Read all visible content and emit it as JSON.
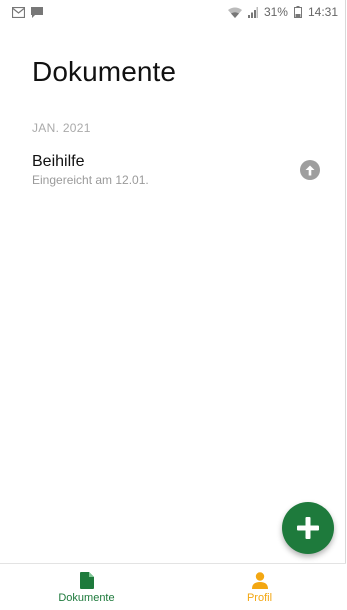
{
  "status_bar": {
    "battery_percent": "31%",
    "time": "14:31",
    "left_icons": [
      "mail-icon",
      "message-icon"
    ],
    "right_icons": [
      "wifi-icon",
      "signal-icon",
      "battery-icon"
    ]
  },
  "page": {
    "title": "Dokumente"
  },
  "sections": [
    {
      "header": "JAN. 2021",
      "items": [
        {
          "title": "Beihilfe",
          "subtitle": "Eingereicht am 12.01.",
          "status_icon": "arrow-up-icon"
        }
      ]
    }
  ],
  "fab": {
    "icon": "plus-icon",
    "color": "#1e7a3c"
  },
  "bottom_nav": {
    "items": [
      {
        "label": "Dokumente",
        "icon": "document-icon",
        "active": true,
        "color": "#1e7a3c"
      },
      {
        "label": "Profil",
        "icon": "person-icon",
        "active": false,
        "color": "#f3a712"
      }
    ]
  }
}
